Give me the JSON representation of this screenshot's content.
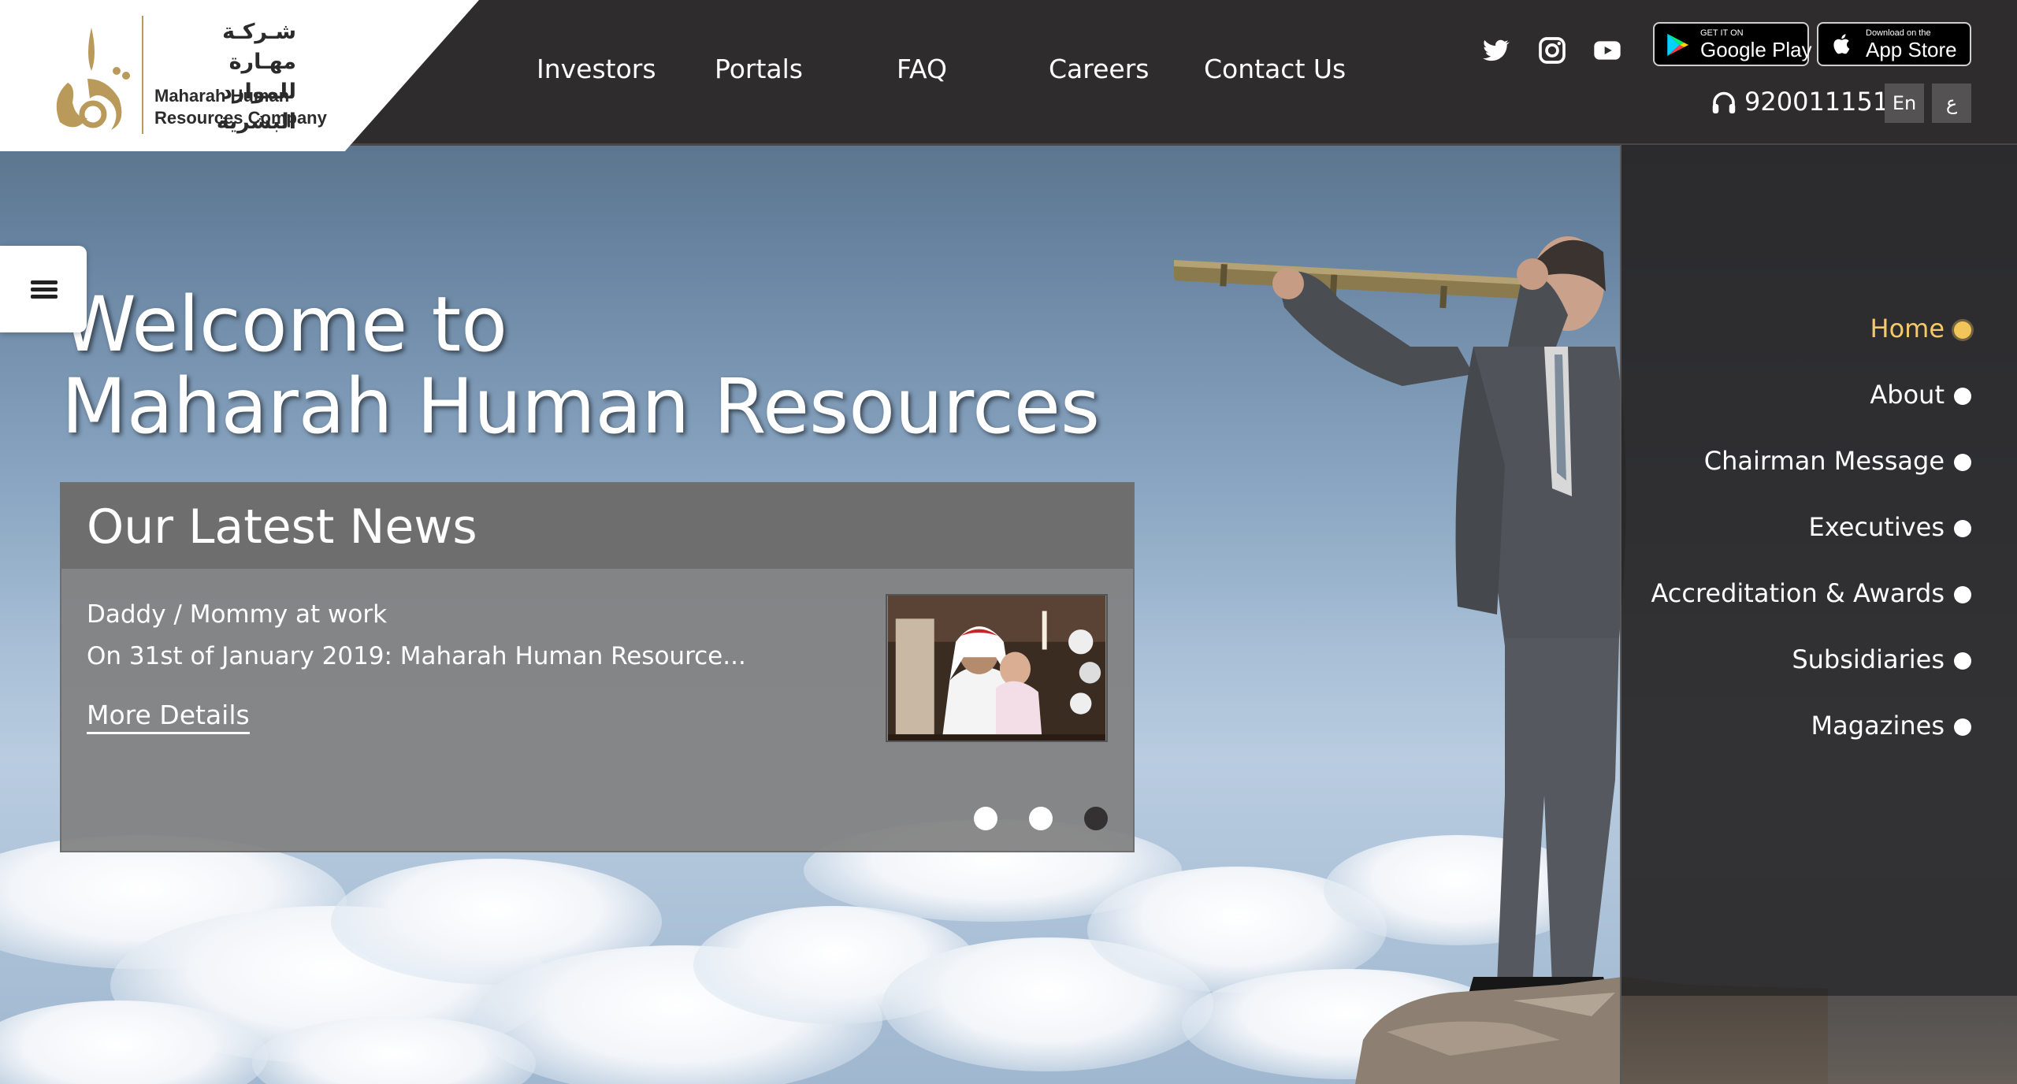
{
  "brand": {
    "name_ar_line1": "شـركـة مهـارة",
    "name_ar_line2": "للموارد البشرية",
    "name_en_line1": "Maharah Human",
    "name_en_line2": "Resources Company"
  },
  "nav": {
    "investors": "Investors",
    "portals": "Portals",
    "faq": "FAQ",
    "careers": "Careers",
    "contact": "Contact Us"
  },
  "stores": {
    "google_small": "GET IT ON",
    "google_big": "Google Play",
    "apple_small": "Download on the",
    "apple_big": "App Store"
  },
  "contact": {
    "phone": "920011151"
  },
  "lang": {
    "en": "En",
    "ar": "ع"
  },
  "hero": {
    "line1": "Welcome to",
    "line2": "Maharah Human Resources"
  },
  "news": {
    "heading": "Our Latest News",
    "item_title": "Daddy / Mommy at work",
    "item_desc": "On 31st of January 2019: Maharah Human Resource...",
    "more": "More Details",
    "slides_total": 3,
    "active_slide": 3
  },
  "sidemenu": {
    "items": [
      {
        "label": "Home",
        "active": true
      },
      {
        "label": "About",
        "active": false
      },
      {
        "label": "Chairman Message",
        "active": false
      },
      {
        "label": "Executives",
        "active": false
      },
      {
        "label": "Accreditation & Awards",
        "active": false
      },
      {
        "label": "Subsidiaries",
        "active": false
      },
      {
        "label": "Magazines",
        "active": false
      }
    ]
  },
  "icons": {
    "social": [
      "twitter-icon",
      "instagram-icon",
      "youtube-icon"
    ],
    "phone": "headset-icon",
    "menu": "hamburger-icon"
  },
  "colors": {
    "topbar": "#2e2c2d",
    "accent_gold": "#f2c55b",
    "panel_gray": "#808080"
  }
}
